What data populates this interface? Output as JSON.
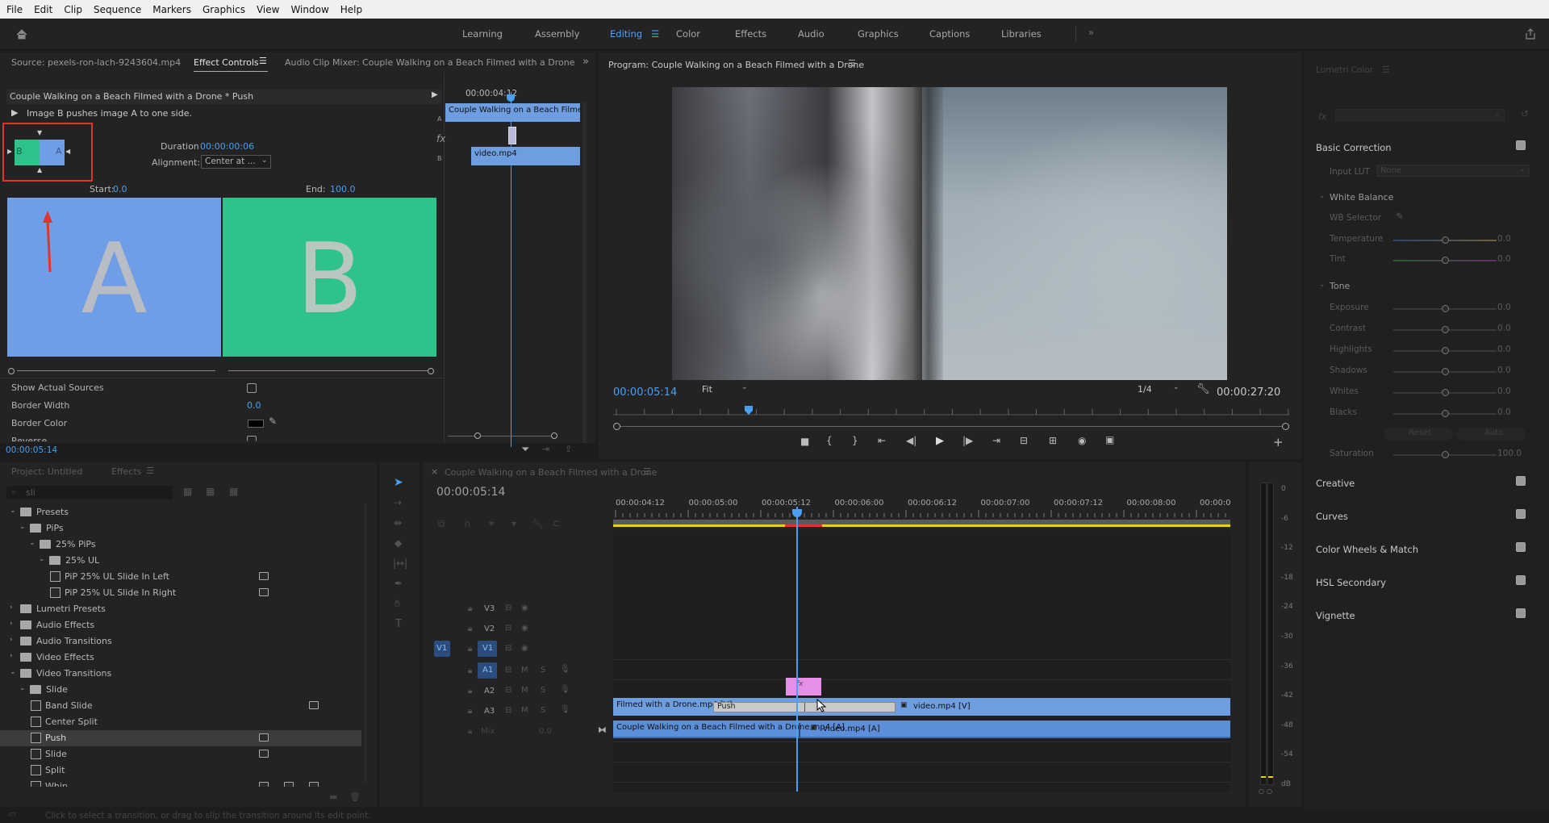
{
  "menu": [
    "File",
    "Edit",
    "Clip",
    "Sequence",
    "Markers",
    "Graphics",
    "View",
    "Window",
    "Help"
  ],
  "workspaces": [
    "Learning",
    "Assembly",
    "Editing",
    "Color",
    "Effects",
    "Audio",
    "Graphics",
    "Captions",
    "Libraries"
  ],
  "active_workspace": "Editing",
  "source_panel": {
    "tabs": {
      "source": "Source: pexels-ron-lach-9243604.mp4",
      "effect_controls": "Effect Controls",
      "audio_mixer": "Audio Clip Mixer: Couple Walking on a Beach Filmed with a Drone"
    },
    "clip_title": "Couple Walking on a Beach Filmed with a Drone * Push",
    "description": "Image B pushes image A to one side.",
    "duration_label": "Duration",
    "duration_value": "00:00:00:06",
    "alignment_label": "Alignment:",
    "alignment_value": "Center at ...",
    "start_label": "Start:",
    "start_value": "0.0",
    "end_label": "End:",
    "end_value": "100.0",
    "preview_a": "A",
    "preview_b": "B",
    "thumb_a": "B",
    "thumb_b": "A",
    "show_actual_sources": "Show Actual Sources",
    "border_width_label": "Border Width",
    "border_width_value": "0.0",
    "border_color_label": "Border Color",
    "reverse_label": "Reverse",
    "timecode": "00:00:05:14",
    "mini_timecode": "00:00:04:12",
    "mini_clip_top": "Couple Walking on a Beach Filmed with a Drone",
    "mini_clip_bottom": "video.mp4",
    "mini_track_a": "A",
    "mini_track_b": "B",
    "fx_label": "fx"
  },
  "program": {
    "title": "Program: Couple Walking on a Beach Filmed with a Drone",
    "timecode": "00:00:05:14",
    "fit": "Fit",
    "resolution": "1/4",
    "duration": "00:00:27:20",
    "playhead_fraction": 0.2
  },
  "lumetri": {
    "title": "Lumetri Color",
    "fx": "fx",
    "basic_correction": "Basic Correction",
    "input_lut_label": "Input LUT",
    "input_lut_value": "None",
    "white_balance": "White Balance",
    "wb_selector": "WB Selector",
    "temperature": {
      "label": "Temperature",
      "value": "0.0"
    },
    "tint": {
      "label": "Tint",
      "value": "0.0"
    },
    "tone": "Tone",
    "tone_rows": [
      {
        "label": "Exposure",
        "value": "0.0"
      },
      {
        "label": "Contrast",
        "value": "0.0"
      },
      {
        "label": "Highlights",
        "value": "0.0"
      },
      {
        "label": "Shadows",
        "value": "0.0"
      },
      {
        "label": "Whites",
        "value": "0.0"
      },
      {
        "label": "Blacks",
        "value": "0.0"
      }
    ],
    "reset": "Reset",
    "auto": "Auto",
    "saturation": {
      "label": "Saturation",
      "value": "100.0"
    },
    "sections": [
      "Creative",
      "Curves",
      "Color Wheels & Match",
      "HSL Secondary",
      "Vignette"
    ]
  },
  "project": {
    "tabs": {
      "project": "Project: Untitled",
      "effects": "Effects"
    },
    "search_value": "sli",
    "tree": [
      {
        "label": "Presets",
        "indent": 1,
        "kind": "folder",
        "open": true
      },
      {
        "label": "PiPs",
        "indent": 2,
        "kind": "folder",
        "open": true
      },
      {
        "label": "25% PiPs",
        "indent": 3,
        "kind": "folder",
        "open": true
      },
      {
        "label": "25% UL",
        "indent": 4,
        "kind": "folder",
        "open": true
      },
      {
        "label": "PiP 25% UL Slide In Left",
        "indent": 5,
        "kind": "preset",
        "badge": 1
      },
      {
        "label": "PiP 25% UL Slide In Right",
        "indent": 5,
        "kind": "preset",
        "badge": 1
      },
      {
        "label": "Lumetri Presets",
        "indent": 1,
        "kind": "folder",
        "open": false
      },
      {
        "label": "Audio Effects",
        "indent": 1,
        "kind": "folder",
        "open": false
      },
      {
        "label": "Audio Transitions",
        "indent": 1,
        "kind": "folder",
        "open": false
      },
      {
        "label": "Video Effects",
        "indent": 1,
        "kind": "folder",
        "open": false
      },
      {
        "label": "Video Transitions",
        "indent": 1,
        "kind": "folder",
        "open": true
      },
      {
        "label": "Slide",
        "indent": 2,
        "kind": "folder",
        "open": true
      },
      {
        "label": "Band Slide",
        "indent": 3,
        "kind": "effect",
        "badge": 3
      },
      {
        "label": "Center Split",
        "indent": 3,
        "kind": "effect",
        "badge": 0
      },
      {
        "label": "Push",
        "indent": 3,
        "kind": "effect",
        "badge": 1,
        "selected": true
      },
      {
        "label": "Slide",
        "indent": 3,
        "kind": "effect",
        "badge": 1
      },
      {
        "label": "Split",
        "indent": 3,
        "kind": "effect",
        "badge": 0
      },
      {
        "label": "Whip",
        "indent": 3,
        "kind": "effect",
        "badge": 3
      }
    ]
  },
  "timeline": {
    "title": "Couple Walking on a Beach Filmed with a Drone",
    "timecode": "00:00:05:14",
    "ruler": [
      "00:00:04:12",
      "00:00:05:00",
      "00:00:05:12",
      "00:00:06:00",
      "00:00:06:12",
      "00:00:07:00",
      "00:00:07:12",
      "00:00:08:00",
      "00:00:0"
    ],
    "tracks": {
      "v3": "V3",
      "v2": "V2",
      "v1": "V1",
      "a1": "A1",
      "a2": "A2",
      "a3": "A3",
      "mix": "Mix",
      "mix_value": "0.0",
      "v1_src": "V1",
      "m": "M",
      "s": "S"
    },
    "clips": {
      "v1_left": "Filmed with a Drone.mp4 [V]",
      "transition": "Push",
      "v1_right": "video.mp4 [V]",
      "a1_left": "Couple Walking on a Beach Filmed with a Drone.mp4 [A]",
      "a1_right": "video.mp4 [A]",
      "v2_fx": "fx"
    }
  },
  "meter": {
    "labels": [
      "0",
      "-6",
      "-12",
      "-18",
      "-24",
      "-30",
      "-36",
      "-42",
      "-48",
      "-54",
      "dB"
    ]
  },
  "status_bar": "Click to select a transition, or drag to slip the transition around its edit point.",
  "colors": {
    "accent": "#4a9ff0",
    "clip_video": "#6e9ee0",
    "clip_audio": "#5d8ed8",
    "preview_a": "#6f9ee6",
    "preview_b": "#2ec38a",
    "v2_clip": "#e58fe6",
    "work_area": "#e9d20f",
    "highlight": "#e0342c"
  }
}
